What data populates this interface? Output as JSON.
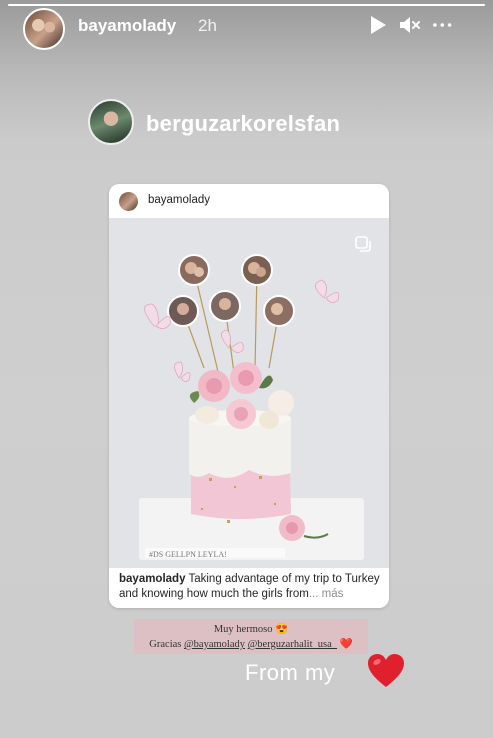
{
  "story": {
    "progress_fraction": 1.0,
    "username": "bayamolady",
    "time": "2h"
  },
  "icons": {
    "play": "play-icon",
    "mute": "speaker-muted-icon",
    "more": "more-dots-icon",
    "multi": "multiple-posts-icon",
    "heart": "red-heart-icon"
  },
  "mention": {
    "username": "berguzarkorelsfan"
  },
  "post": {
    "username": "bayamolady",
    "caption_user": "bayamolady",
    "caption_text": " Taking advantage of my trip to Turkey and knowing how much the girls from",
    "caption_more": "... más"
  },
  "note": {
    "line1": "Muy hermoso 😍",
    "line2_prefix": "Gracias ",
    "mention1": "@bayamolady",
    "mention2": "@berguzarhalit_usa_",
    "heart": "❤️"
  },
  "overlay": {
    "text": "From my"
  },
  "colors": {
    "heart_red": "#e0202d",
    "note_bg": "#dcc0c4",
    "cake_pink": "#f2c6d4"
  }
}
